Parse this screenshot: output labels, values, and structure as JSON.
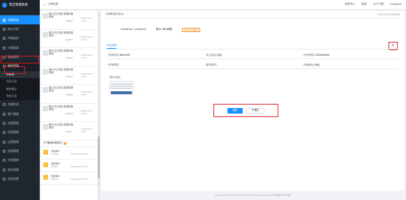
{
  "app": {
    "name": "帮宜管理系统"
  },
  "header": {
    "breadcrumb": [
      "工单处理"
    ],
    "right": [
      "消息中心",
      "帮助",
      "APP下载",
      "zhangleile"
    ]
  },
  "sidebar": {
    "items": [
      {
        "label": "车辆信息",
        "active": true
      },
      {
        "label": "统计分析"
      },
      {
        "label": "车辆监控"
      },
      {
        "label": "车辆报表"
      },
      {
        "label": "数据报表"
      },
      {
        "label": "稽核管理",
        "open": true
      },
      {
        "label": "车辆信息"
      },
      {
        "label": "客户管理"
      },
      {
        "label": "设备管理"
      },
      {
        "label": "权限管理"
      },
      {
        "label": "运营管理"
      },
      {
        "label": "流量管理"
      },
      {
        "label": "车险管理"
      },
      {
        "label": "账务管理"
      },
      {
        "label": "系统设置"
      }
    ],
    "sub_items": [
      {
        "label": "待审核",
        "current": true
      },
      {
        "label": "消息记录"
      },
      {
        "label": "维修确认"
      },
      {
        "label": "审核记录"
      }
    ]
  },
  "list": {
    "cards": [
      {
        "title": "图片无正常拍 数据采集错误",
        "code": "356540",
        "date": "2019-02-28 15:40"
      },
      {
        "title": "图片无正常拍 数据采集错误",
        "code": "aa2017",
        "date": "2019-02-28 15:38"
      },
      {
        "title": "图片无正常拍 数据采集错误",
        "code": "aa0004",
        "date": "2019-02-28 15:31"
      },
      {
        "title": "图片无正常拍 数据采集错误",
        "code": "165516",
        "date": "2019-02-28 15:27"
      },
      {
        "title": "图片无正常拍 数据采集错误",
        "code": "165510",
        "date": "2019-02-28 15:20"
      },
      {
        "title": "图片无正常拍 数据采集错误",
        "code": "wi28413",
        "date": "2019-02-28 14:55"
      },
      {
        "title": "图片无正常拍 数据采集错误",
        "code": "wi1415",
        "date": "2019-02-28 14:38"
      }
    ],
    "section_title": "ICP备案审核操作",
    "section_badge": "1",
    "feed": [
      {
        "title": "内容审中",
        "code": "FY0049",
        "date": "2019-02-28 11:22"
      },
      {
        "title": "内容审中",
        "code": "wi0995",
        "date": "2019-02-28 14:01"
      },
      {
        "title": "内容审中",
        "code": "2a0049",
        "date": "2019-02-28 14:03"
      }
    ]
  },
  "detail": {
    "header_left": "可用易证补证(0)",
    "header_time": "2019-02-28 15:58:53",
    "name": "undefined / undefined",
    "price_label": "售价:",
    "price": "¥0.00元",
    "tag": "补充证件或备注",
    "section_title": "车主信息",
    "info_rows": [
      [
        {
          "k": "[车辆号码]",
          "v": "粤A00989"
        },
        {
          "k": "[车主姓名]",
          "v": "测试"
        },
        {
          "k": "[手机号码]",
          "v": "13255556666"
        }
      ],
      [
        {
          "k": "[车辆类型]",
          "v": ""
        },
        {
          "k": "[服务城市]",
          "v": ""
        },
        {
          "k": "[详细地址]",
          "v": "地址"
        }
      ]
    ],
    "image_label": "[照片信息]",
    "buttons": {
      "approve": "通过",
      "reject": "不通过"
    },
    "edit_icon": "pencil-icon"
  },
  "footer": {
    "text": "Powered by Rain Cloud ©2019 Rain Cloud All rights reserved     ICP备案号       粤ICP备"
  }
}
